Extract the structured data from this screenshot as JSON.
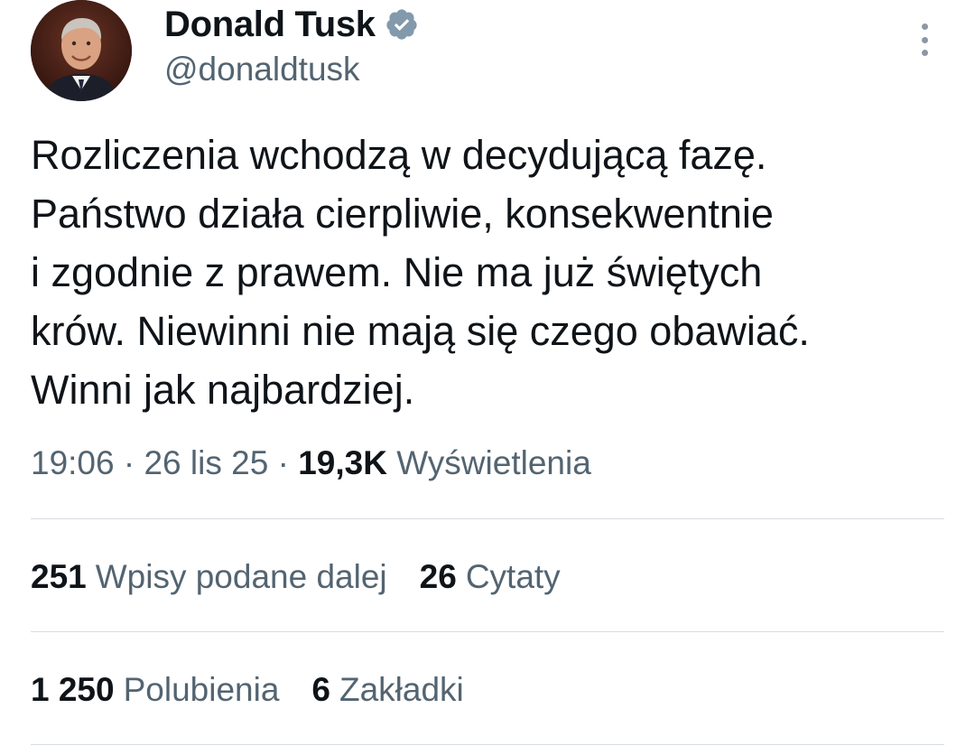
{
  "author": {
    "display_name": "Donald Tusk",
    "handle": "@donaldtusk",
    "verified": true
  },
  "tweet": {
    "lines": [
      "Rozliczenia wchodzą w decydującą fazę.",
      "Państwo działa cierpliwie, konsekwentnie",
      "i zgodnie z prawem. Nie ma już świętych",
      "krów. Niewinni nie mają się czego obawiać.",
      "Winni jak najbardziej."
    ]
  },
  "meta": {
    "time": "19:06",
    "separator": " · ",
    "date": "26 lis 25",
    "views_count": "19,3K",
    "views_label": "Wyświetlenia"
  },
  "stats": {
    "reposts_count": "251",
    "reposts_label": "Wpisy podane dalej",
    "quotes_count": "26",
    "quotes_label": "Cytaty",
    "likes_count": "1 250",
    "likes_label": "Polubienia",
    "bookmarks_count": "6",
    "bookmarks_label": "Zakładki"
  },
  "colors": {
    "text_primary": "#0f1419",
    "text_secondary": "#536471",
    "verified_badge": "#829aab",
    "divider": "#d7dde2"
  },
  "icons": {
    "verified": "verified-badge-icon",
    "more": "more-vertical-icon"
  }
}
